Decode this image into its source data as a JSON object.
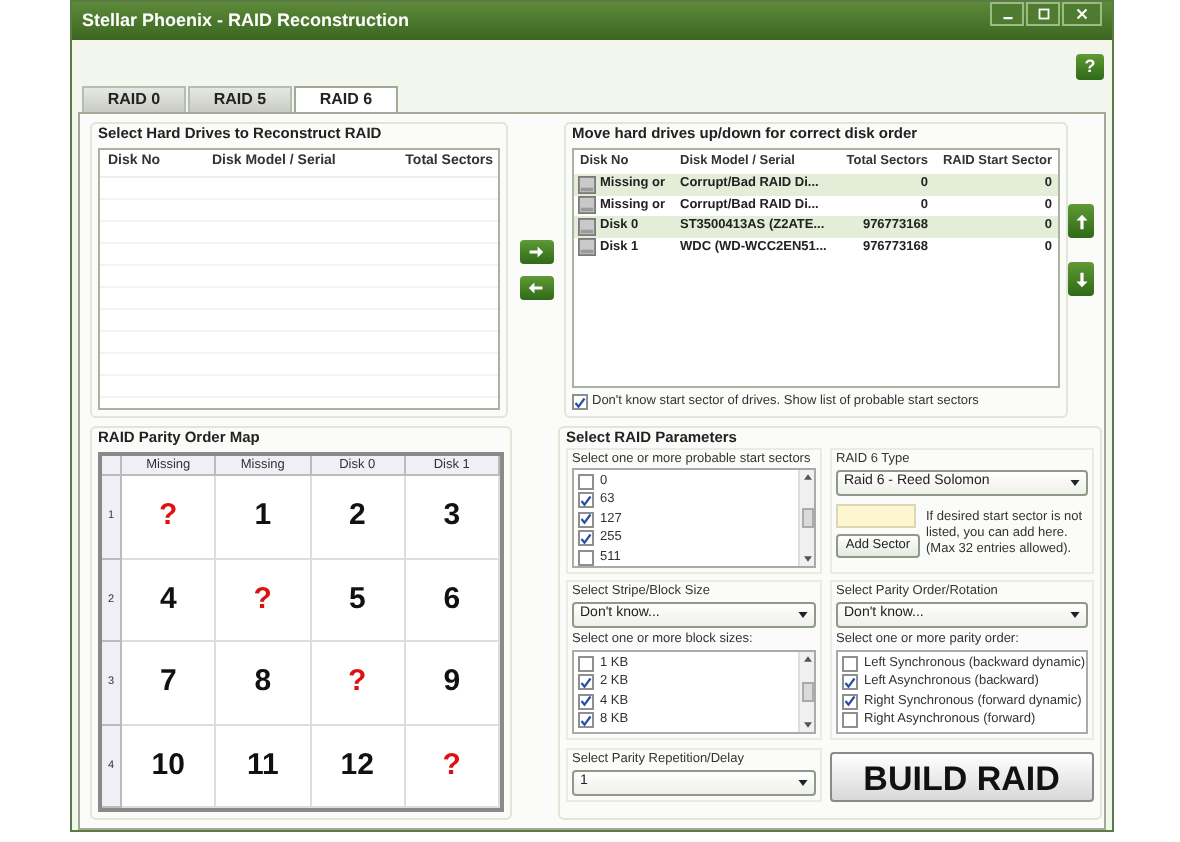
{
  "window": {
    "title": "Stellar Phoenix - RAID Reconstruction"
  },
  "help_button": "?",
  "tabs": [
    {
      "label": "RAID 0",
      "selected": false
    },
    {
      "label": "RAID 5",
      "selected": false
    },
    {
      "label": "RAID 6",
      "selected": true
    }
  ],
  "drive_source": {
    "title": "Select Hard Drives to Reconstruct RAID",
    "columns": [
      "Disk No",
      "Disk Model / Serial",
      "Total Sectors"
    ]
  },
  "disk_order": {
    "title": "Move hard drives up/down for correct disk order",
    "columns": [
      "Disk No",
      "Disk Model / Serial",
      "Total Sectors",
      "RAID Start Sector"
    ],
    "rows": [
      {
        "disk_no": "Missing or",
        "model": "Corrupt/Bad RAID Di...",
        "total_sectors": "0",
        "start_sector": "0"
      },
      {
        "disk_no": "Missing or",
        "model": "Corrupt/Bad RAID Di...",
        "total_sectors": "0",
        "start_sector": "0"
      },
      {
        "disk_no": "Disk 0",
        "model": "ST3500413AS (Z2ATE...",
        "total_sectors": "976773168",
        "start_sector": "0"
      },
      {
        "disk_no": "Disk 1",
        "model": "WDC (WD-WCC2EN51...",
        "total_sectors": "976773168",
        "start_sector": "0"
      }
    ],
    "option": {
      "label": "Don't know start sector of drives. Show list of probable start sectors",
      "checked": true
    }
  },
  "parity_map": {
    "title": "RAID Parity Order Map",
    "columns": [
      "Missing",
      "Missing",
      "Disk 0",
      "Disk 1"
    ],
    "rows": [
      {
        "label": "1",
        "cells": [
          {
            "text": "?",
            "kind": "parity"
          },
          {
            "text": "1",
            "kind": "data"
          },
          {
            "text": "2",
            "kind": "data"
          },
          {
            "text": "3",
            "kind": "data"
          }
        ]
      },
      {
        "label": "2",
        "cells": [
          {
            "text": "4",
            "kind": "data"
          },
          {
            "text": "?",
            "kind": "parity"
          },
          {
            "text": "5",
            "kind": "data"
          },
          {
            "text": "6",
            "kind": "data"
          }
        ]
      },
      {
        "label": "3",
        "cells": [
          {
            "text": "7",
            "kind": "data"
          },
          {
            "text": "8",
            "kind": "data"
          },
          {
            "text": "?",
            "kind": "parity"
          },
          {
            "text": "9",
            "kind": "data"
          }
        ]
      },
      {
        "label": "4",
        "cells": [
          {
            "text": "10",
            "kind": "data"
          },
          {
            "text": "11",
            "kind": "data"
          },
          {
            "text": "12",
            "kind": "data"
          },
          {
            "text": "?",
            "kind": "parity"
          }
        ]
      }
    ]
  },
  "params": {
    "title": "Select RAID Parameters",
    "start_sectors": {
      "label": "Select one or more probable start sectors",
      "items": [
        {
          "label": "0",
          "checked": false
        },
        {
          "label": "63",
          "checked": true
        },
        {
          "label": "127",
          "checked": true
        },
        {
          "label": "255",
          "checked": true
        },
        {
          "label": "511",
          "checked": false
        }
      ]
    },
    "raid_type": {
      "label": "RAID 6 Type",
      "value": "Raid 6 - Reed Solomon"
    },
    "add_sector": {
      "hint": "If desired start sector is not listed, you can add here. (Max 32 entries allowed).",
      "button": "Add Sector"
    },
    "stripe": {
      "label": "Select Stripe/Block Size",
      "value": "Don't know..."
    },
    "parity_order": {
      "label": "Select Parity Order/Rotation",
      "value": "Don't know..."
    },
    "block_sizes": {
      "label": "Select one or more block sizes:",
      "items": [
        {
          "label": "1 KB",
          "checked": false
        },
        {
          "label": "2 KB",
          "checked": true
        },
        {
          "label": "4 KB",
          "checked": true
        },
        {
          "label": "8 KB",
          "checked": true
        }
      ]
    },
    "parity_orders": {
      "label": "Select one or more parity order:",
      "items": [
        {
          "label": "Left Synchronous (backward dynamic)",
          "checked": false
        },
        {
          "label": "Left Asynchronous (backward)",
          "checked": true
        },
        {
          "label": "Right Synchronous (forward dynamic)",
          "checked": true
        },
        {
          "label": "Right Asynchronous (forward)",
          "checked": false
        }
      ]
    },
    "delay": {
      "label": "Select Parity Repetition/Delay",
      "value": "1"
    },
    "build_button": "BUILD RAID"
  }
}
